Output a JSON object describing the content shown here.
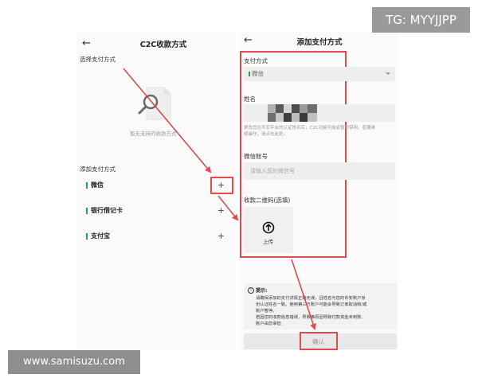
{
  "left_screen": {
    "back_icon": "←",
    "title": "C2C收款方式",
    "section_select": "选择支付方式",
    "empty_text": "暂无支持的收款方式",
    "section_add": "添加支付方式",
    "methods": [
      {
        "label": "微信",
        "action": "+"
      },
      {
        "label": "银行借记卡",
        "action": "+"
      },
      {
        "label": "支付宝",
        "action": "+"
      }
    ]
  },
  "right_screen": {
    "back_icon": "←",
    "title": "添加支付方式",
    "pay_method_label": "支付方式",
    "pay_method_value": "微信",
    "name_label": "姓名",
    "name_hint_line1": "更改您在币安平台的认证姓名后，C2C功能可能会暂时禁用，若要继",
    "name_hint_line2": "续操作，请点击此处。",
    "account_label": "微信账号",
    "account_placeholder": "请输入您的微信号",
    "qr_label": "收款二维码(选填)",
    "upload_label": "上传",
    "tips_title": "提示:",
    "tips_line1": "请确保添加的支付详情正确无误，且姓名与您的币安账户身",
    "tips_line2": "份认证姓名一致。使用第三方账户可能会导致订单取消和/或",
    "tips_line3": "账户暂停。",
    "tips_line4": "若因您的收款信息错误，导致等原因导致付款资金未到账,",
    "tips_line5": "账户由您承担",
    "confirm_label": "确认"
  },
  "watermarks": {
    "telegram": "TG: MYYJJPP",
    "site": "www.samisuzu.com"
  },
  "colors": {
    "accent_green": "#27a544",
    "annotation_red": "#e04b4b",
    "field_grey": "#eeeeee"
  },
  "icons": [
    "back-arrow-icon",
    "search-empty-icon",
    "plus-icon",
    "dropdown-caret-icon",
    "upload-arrow-icon",
    "info-icon"
  ]
}
